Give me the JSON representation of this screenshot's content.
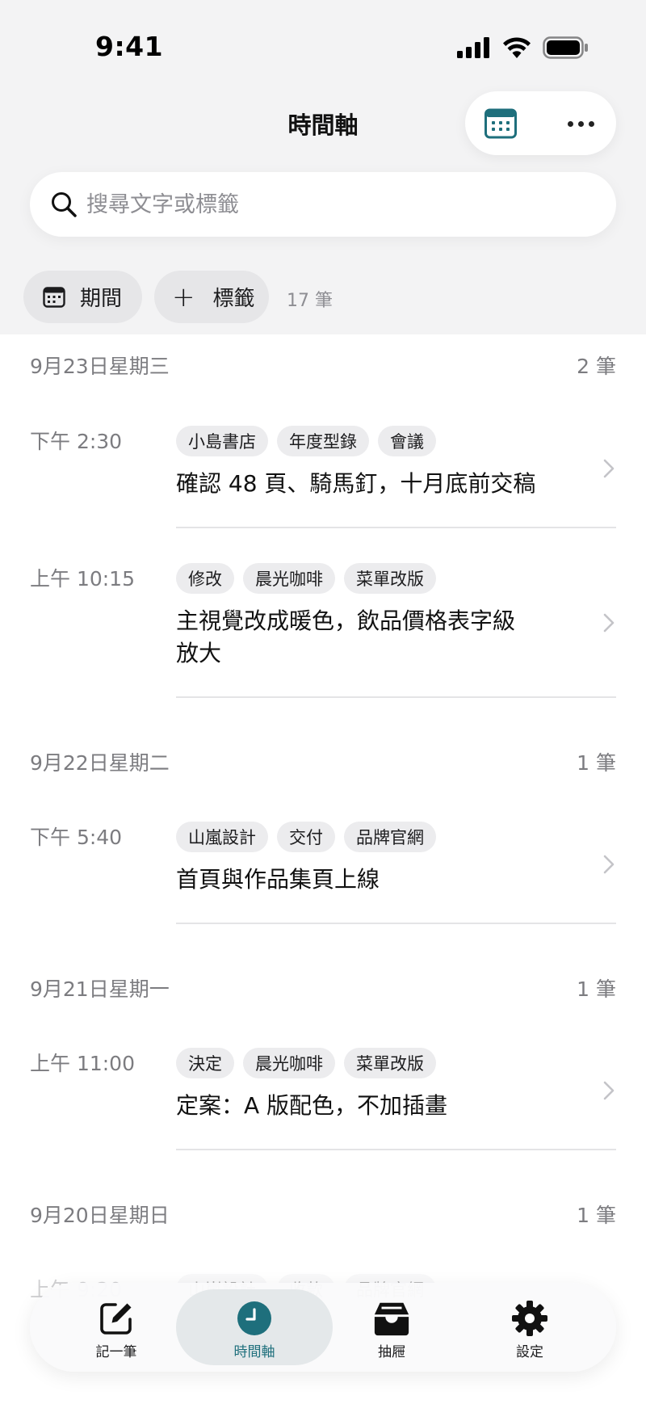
{
  "status_bar": {
    "time": "9:41"
  },
  "nav": {
    "title": "時間軸",
    "calendar_icon": "calendar-icon",
    "more_icon": "ellipsis-icon"
  },
  "search": {
    "placeholder": "搜尋文字或標籤",
    "value": ""
  },
  "filters": {
    "period_label": "期間",
    "tag_label": "標籤",
    "tag_plus": "+",
    "count": "17 筆"
  },
  "days": [
    {
      "date": "9月23日星期三",
      "count": "2 筆",
      "entries": [
        {
          "time": "下午 2:30",
          "tags": [
            "小島書店",
            "年度型錄",
            "會議"
          ],
          "text": "確認 48 頁、騎馬釘，十月底前交稿"
        },
        {
          "time": "上午 10:15",
          "tags": [
            "修改",
            "晨光咖啡",
            "菜單改版"
          ],
          "text": "主視覺改成暖色，飲品價格表字級放大"
        }
      ]
    },
    {
      "date": "9月22日星期二",
      "count": "1 筆",
      "entries": [
        {
          "time": "下午 5:40",
          "tags": [
            "山嵐設計",
            "交付",
            "品牌官網"
          ],
          "text": "首頁與作品集頁上線"
        }
      ]
    },
    {
      "date": "9月21日星期一",
      "count": "1 筆",
      "entries": [
        {
          "time": "上午 11:00",
          "tags": [
            "決定",
            "晨光咖啡",
            "菜單改版"
          ],
          "text": "定案：A 版配色，不加插畫"
        }
      ]
    },
    {
      "date": "9月20日星期日",
      "count": "1 筆",
      "entries": [
        {
          "time": "上午 9:20",
          "tags": [
            "山嵐設計",
            "收款",
            "品牌官網"
          ],
          "text": ""
        }
      ]
    }
  ],
  "tab_bar": {
    "tabs": [
      {
        "label": "記一筆",
        "icon": "compose-icon"
      },
      {
        "label": "時間軸",
        "icon": "clock-icon",
        "active": true
      },
      {
        "label": "抽屜",
        "icon": "drawer-icon"
      },
      {
        "label": "設定",
        "icon": "gear-icon"
      }
    ]
  },
  "colors": {
    "accent": "#1e6f7c",
    "background_top": "#f3f3f4",
    "tag_bg": "#ececee",
    "secondary_text": "#7c7c80"
  }
}
